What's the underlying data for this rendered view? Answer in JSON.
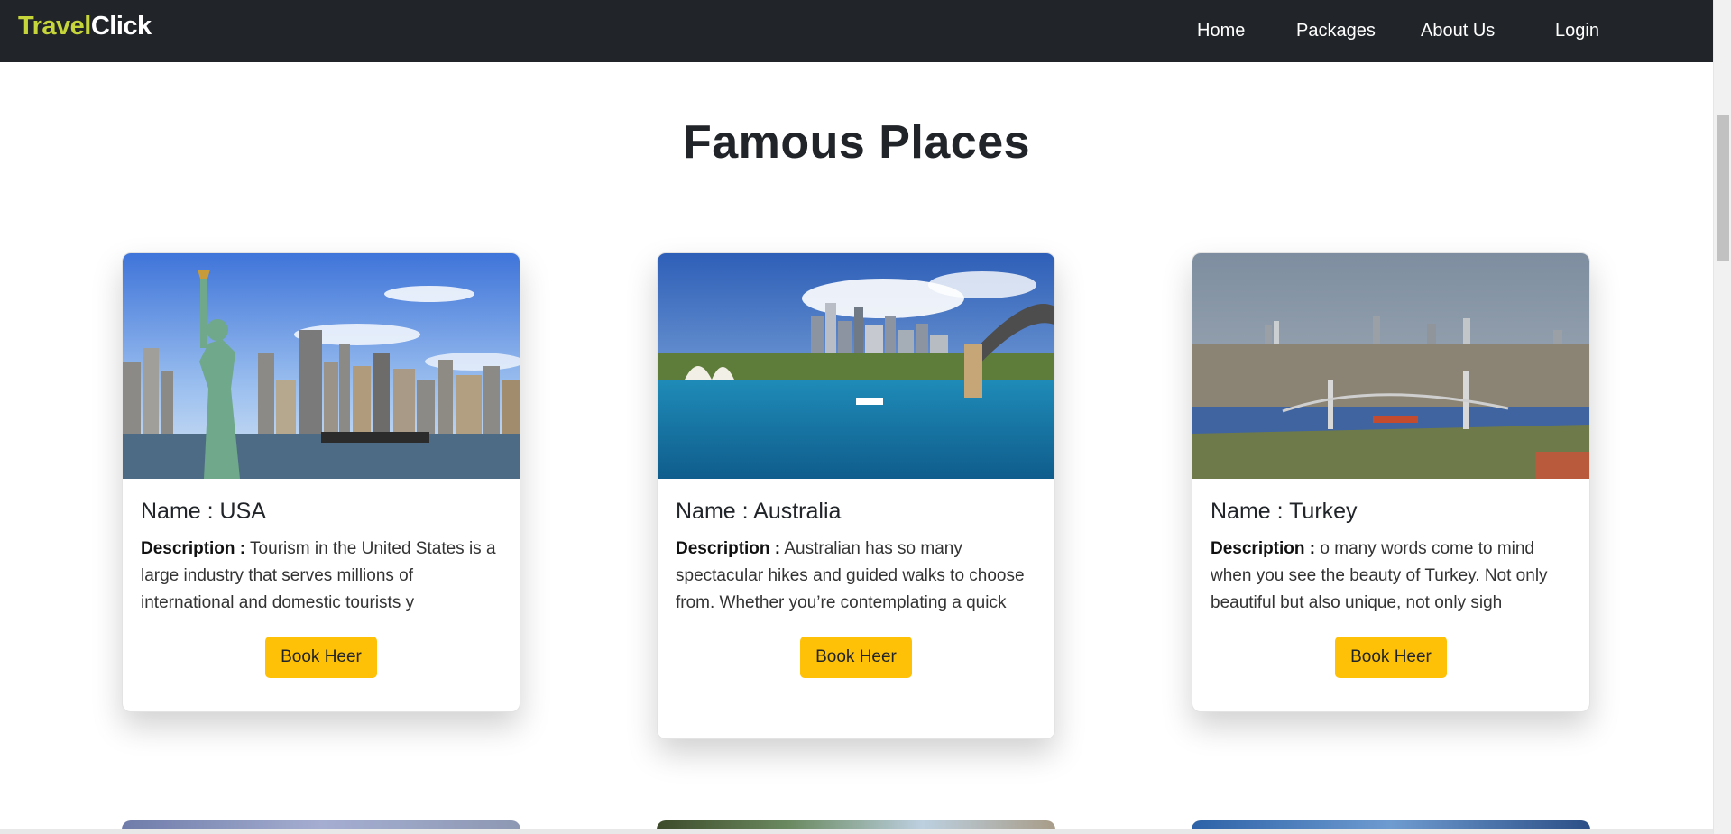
{
  "brand": {
    "part1": "Travel",
    "part2": "Click"
  },
  "nav": {
    "home": "Home",
    "packages": "Packages",
    "about": "About Us",
    "login": "Login"
  },
  "page_title": "Famous Places",
  "cards": [
    {
      "title": "Name : USA",
      "desc_label": "Description :",
      "desc_text": " Tourism in the United States is a large industry that serves millions of international and domestic tourists y",
      "button": "Book Heer"
    },
    {
      "title": "Name : Australia",
      "desc_label": "Description :",
      "desc_text": " Australian has so many spectacular hikes and guided walks to choose from. Whether you’re contemplating a quick",
      "button": "Book Heer"
    },
    {
      "title": "Name : Turkey",
      "desc_label": "Description :",
      "desc_text": " o many words come to mind when you see the beauty of Turkey. Not only beautiful but also unique, not only sigh",
      "button": "Book Heer"
    }
  ],
  "colors": {
    "navbar": "#212529",
    "brand_accent": "#c6d53a",
    "button": "#ffc107"
  }
}
